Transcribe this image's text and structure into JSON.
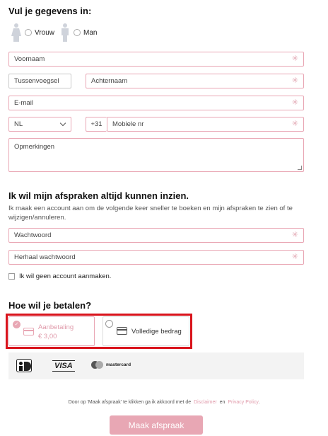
{
  "form": {
    "section1_title": "Vul je gegevens in:",
    "gender": {
      "female_label": "Vrouw",
      "male_label": "Man"
    },
    "fields": {
      "firstname": "Voornaam",
      "infix": "Tussenvoegsel",
      "lastname": "Achternaam",
      "email": "E-mail",
      "country": "NL",
      "dial_code": "+31",
      "mobile": "Mobiele nr",
      "remarks": "Opmerkingen"
    },
    "required_marker": "✳"
  },
  "account": {
    "title": "Ik wil mijn afspraken altijd kunnen inzien.",
    "description": "Ik maak een account aan om de volgende keer sneller te boeken en mijn afspraken te zien of te wijzigen/annuleren.",
    "password": "Wachtwoord",
    "password_repeat": "Herhaal wachtwoord",
    "no_account_label": "Ik wil geen account aanmaken."
  },
  "payment": {
    "title": "Hoe wil je betalen?",
    "options": [
      {
        "label": "Aanbetaling",
        "amount": "€ 3,00",
        "selected": true
      },
      {
        "label": "Volledige bedrag",
        "selected": false
      }
    ],
    "methods": [
      "ideal-icon",
      "VISA",
      "mastercard"
    ]
  },
  "legal": {
    "text_before": "Door op 'Maak afspraak' te klikken ga ik akkoord met de",
    "disclaimer": "Disclaimer",
    "and": "en",
    "privacy": "Privacy Policy",
    "end": "."
  },
  "submit_label": "Maak afspraak",
  "colors": {
    "accent": "#e8a7b4",
    "highlight": "#d9141c"
  }
}
